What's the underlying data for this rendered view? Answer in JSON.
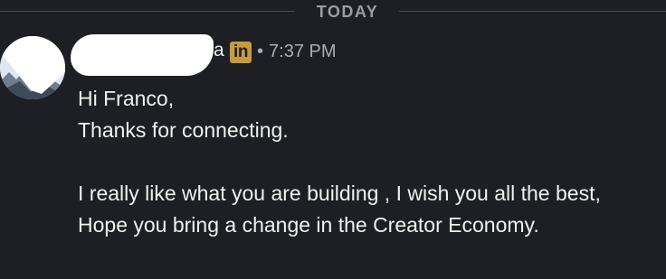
{
  "divider": {
    "label": "TODAY"
  },
  "message": {
    "sender_visible_suffix": "a",
    "platform_badge": "in",
    "bullet": "•",
    "time": "7:37 PM",
    "lines": [
      "Hi Franco,",
      "Thanks for connecting.",
      "",
      "I really like what you are building , I wish you all the best,",
      "Hope you bring a change in the Creator Economy."
    ]
  },
  "colors": {
    "background": "#1d1f24",
    "text": "#f0f0f0",
    "muted": "#a9acb2",
    "badge": "#c79a3f"
  }
}
